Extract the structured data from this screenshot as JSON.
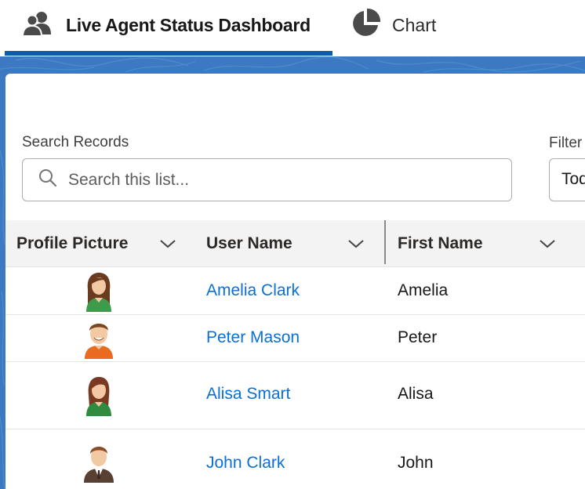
{
  "tabs": [
    {
      "label": "Live Agent Status Dashboard",
      "icon": "users-icon",
      "active": true
    },
    {
      "label": "Chart",
      "icon": "pie-chart-icon",
      "active": false
    }
  ],
  "colors": {
    "accent": "#0b5cab",
    "background_blue": "#3c79c2",
    "link": "#0b6fd3"
  },
  "search": {
    "label": "Search Records",
    "placeholder": "Search this list...",
    "value": ""
  },
  "filter": {
    "label": "Filter",
    "value": "Today"
  },
  "table": {
    "columns": [
      "Profile Picture",
      "User Name",
      "First Name"
    ],
    "rows": [
      {
        "user_name": "Amelia Clark",
        "first_name": "Amelia",
        "avatar": "female-avatar-icon"
      },
      {
        "user_name": "Peter Mason",
        "first_name": "Peter",
        "avatar": "male-avatar-icon"
      },
      {
        "user_name": "Alisa Smart",
        "first_name": "Alisa",
        "avatar": "female-avatar-icon"
      },
      {
        "user_name": "John Clark",
        "first_name": "John",
        "avatar": "male-suit-avatar-icon"
      }
    ]
  }
}
